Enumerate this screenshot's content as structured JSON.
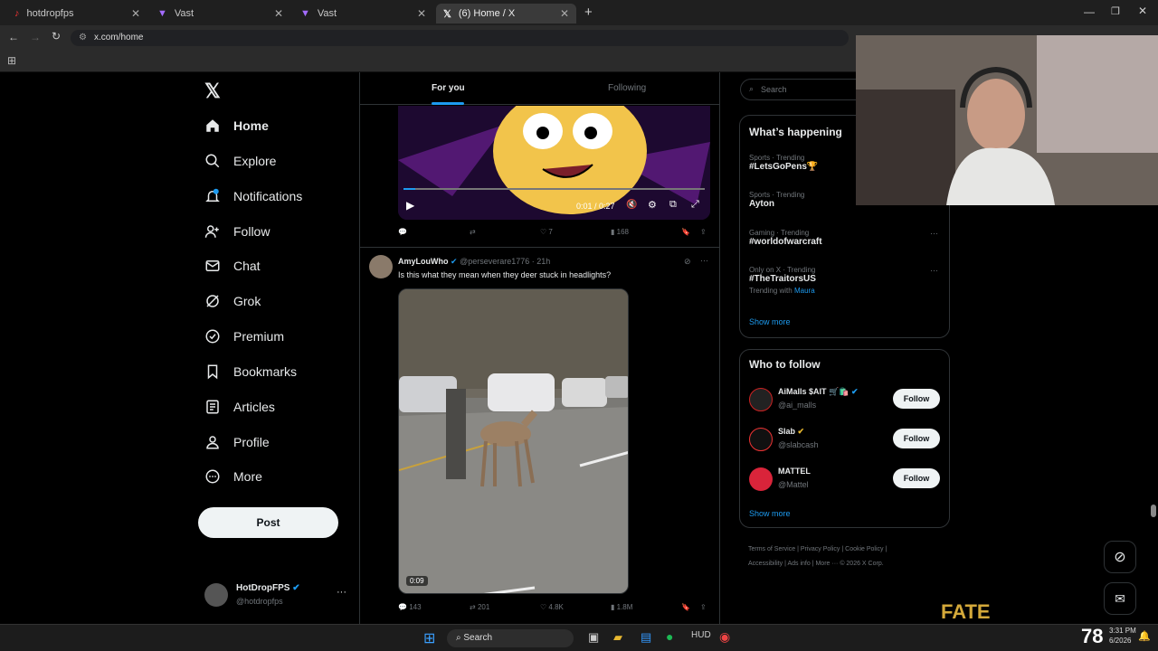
{
  "browser": {
    "tabs": [
      {
        "label": "hotdropfps"
      },
      {
        "label": "Vast"
      },
      {
        "label": "Vast"
      },
      {
        "label": "(6) Home / X"
      }
    ],
    "url": "x.com/home"
  },
  "nav": {
    "items": [
      {
        "label": "Home"
      },
      {
        "label": "Explore"
      },
      {
        "label": "Notifications"
      },
      {
        "label": "Follow"
      },
      {
        "label": "Chat"
      },
      {
        "label": "Grok"
      },
      {
        "label": "Premium"
      },
      {
        "label": "Bookmarks"
      },
      {
        "label": "Articles"
      },
      {
        "label": "Profile"
      },
      {
        "label": "More"
      }
    ],
    "post_label": "Post",
    "account": {
      "name": "HotDropFPS",
      "handle": "@hotdropfps"
    }
  },
  "feed": {
    "tabs": {
      "for_you": "For you",
      "following": "Following"
    },
    "prev_post": {
      "time": "0:01 / 0:27",
      "likes": "7",
      "views": "168"
    },
    "post": {
      "author": "AmyLouWho",
      "handle": "@perseverare1776",
      "age": "· 21h",
      "text": "Is this what they mean when they deer stuck in headlights?",
      "duration": "0:09",
      "replies": "143",
      "reposts": "201",
      "likes": "4.8K",
      "views": "1.8M"
    }
  },
  "right": {
    "search_placeholder": "Search",
    "happening_title": "What’s happening",
    "trends": [
      {
        "context": "Sports · Trending",
        "name": "#LetsGoPens🏆"
      },
      {
        "context": "Sports · Trending",
        "name": "Ayton"
      },
      {
        "context": "Gaming · Trending",
        "name": "#worldofwarcraft"
      },
      {
        "context": "Only on X · Trending",
        "name": "#TheTraitorsUS",
        "extra_prefix": "Trending with",
        "extra_link": "Maura"
      }
    ],
    "show_more": "Show more",
    "who_title": "Who to follow",
    "who": [
      {
        "name": "AiMalls $AIT 🛒🛍️",
        "handle": "@ai_malls",
        "follow": "Follow"
      },
      {
        "name": "Slab",
        "handle": "@slabcash",
        "follow": "Follow"
      },
      {
        "name": "MATTEL",
        "handle": "@Mattel",
        "follow": "Follow"
      }
    ],
    "footer": [
      "Terms of Service",
      "Privacy Policy",
      "Cookie Policy",
      "Accessibility",
      "Ads info",
      "More ···",
      "© 2026 X Corp."
    ]
  },
  "taskbar": {
    "search": "Search",
    "time": "3:31 PM",
    "date": "6/2026",
    "overlay_number": "78",
    "overlay_logo": "FATE"
  },
  "colors": {
    "accent": "#1d9bf0",
    "bg": "#000000",
    "border": "#2f3336",
    "muted": "#71767b"
  }
}
